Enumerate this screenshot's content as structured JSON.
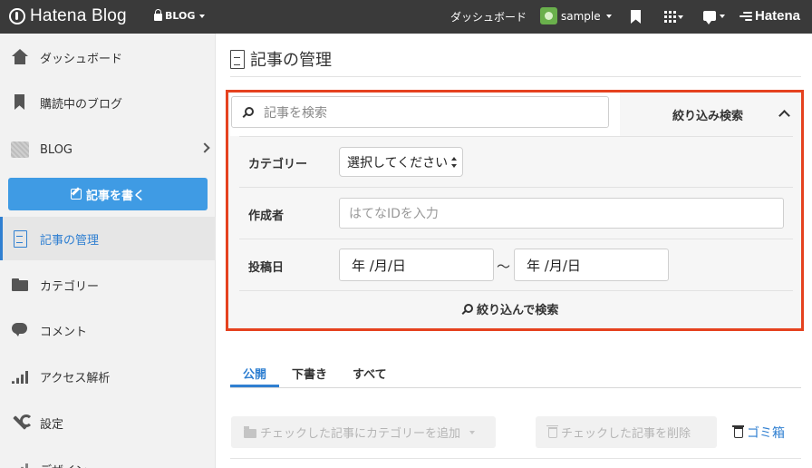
{
  "topbar": {
    "logo_text": "Hatena Blog",
    "blog_selector": "BLOG",
    "dashboard": "ダッシュボード",
    "username": "sample",
    "hatena": "Hatena"
  },
  "sidebar": {
    "items": [
      {
        "label": "ダッシュボード",
        "icon": "home-icon"
      },
      {
        "label": "購読中のブログ",
        "icon": "bookmark-icon"
      },
      {
        "label": "BLOG",
        "icon": "blog-thumbnail"
      },
      {
        "label": "記事の管理",
        "icon": "document-icon"
      },
      {
        "label": "カテゴリー",
        "icon": "folder-icon"
      },
      {
        "label": "コメント",
        "icon": "comment-icon"
      },
      {
        "label": "アクセス解析",
        "icon": "bar-chart-icon"
      },
      {
        "label": "設定",
        "icon": "wrench-icon"
      },
      {
        "label": "デザイン",
        "icon": "design-icon"
      }
    ],
    "write_button": "記事を書く"
  },
  "main": {
    "title": "記事の管理",
    "search_placeholder": "記事を検索",
    "narrow_search_toggle": "絞り込み検索",
    "filters": {
      "category_label": "カテゴリー",
      "category_selected": "選択してください",
      "author_label": "作成者",
      "author_placeholder": "はてなIDを入力",
      "date_label": "投稿日",
      "date_from": "年 /月/日",
      "date_sep": "〜",
      "date_to": "年 /月/日",
      "submit": "絞り込んで検索"
    },
    "tabs": [
      "公開",
      "下書き",
      "すべて"
    ],
    "actions": {
      "add_category": "チェックした記事にカテゴリーを追加",
      "delete_checked": "チェックした記事を削除",
      "trash": "ゴミ箱"
    }
  },
  "colors": {
    "accent": "#2f7fd1",
    "highlight_border": "#e5421f",
    "topbar": "#3a3a3a"
  }
}
